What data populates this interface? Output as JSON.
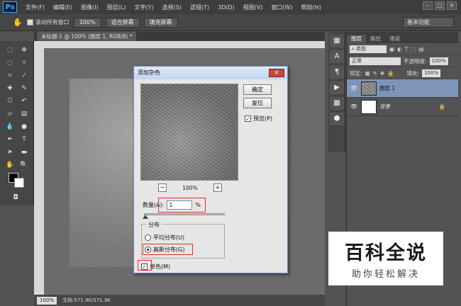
{
  "menubar": {
    "logo": "Ps",
    "items": [
      "文件(F)",
      "编辑(E)",
      "图像(I)",
      "图层(L)",
      "文字(Y)",
      "选择(S)",
      "滤镜(T)",
      "3D(D)",
      "视图(V)",
      "窗口(W)",
      "帮助(H)"
    ]
  },
  "options": {
    "scroll_all": "滚动所有窗口",
    "zoom": "100%",
    "fit_screen": "适合屏幕",
    "fill_screen": "填充屏幕",
    "workspace": "基本功能"
  },
  "document": {
    "tab": "未标题-1 @ 100% (图层 1, RGB/8) *",
    "status_zoom": "100%",
    "status_doc": "文档:571.9K/571.9K"
  },
  "layers_panel": {
    "tabs": [
      "图层",
      "路径",
      "通道"
    ],
    "kind_filter": "类型",
    "blend_mode": "正常",
    "opacity_label": "不透明度:",
    "opacity": "100%",
    "lock_label": "锁定:",
    "fill_label": "填充:",
    "fill": "100%",
    "layers": [
      {
        "name": "图层 1"
      },
      {
        "name": "背景"
      }
    ]
  },
  "dialog": {
    "title": "添加杂色",
    "ok": "确定",
    "reset": "复位",
    "preview_label": "预览(P)",
    "zoom": "100%",
    "amount_label": "数量(A):",
    "amount_value": "1",
    "amount_unit": "%",
    "distribution_label": "分布",
    "uniform": "平均分布(U)",
    "gaussian": "高斯分布(G)",
    "monochromatic": "单色(M)",
    "selected_distribution": "gaussian",
    "preview_checked": true,
    "mono_checked": true
  },
  "watermark": {
    "title": "百科全说",
    "subtitle": "助你轻松解决"
  },
  "colors": {
    "accent": "#e0302a",
    "selected_layer": "#7f95b8"
  }
}
